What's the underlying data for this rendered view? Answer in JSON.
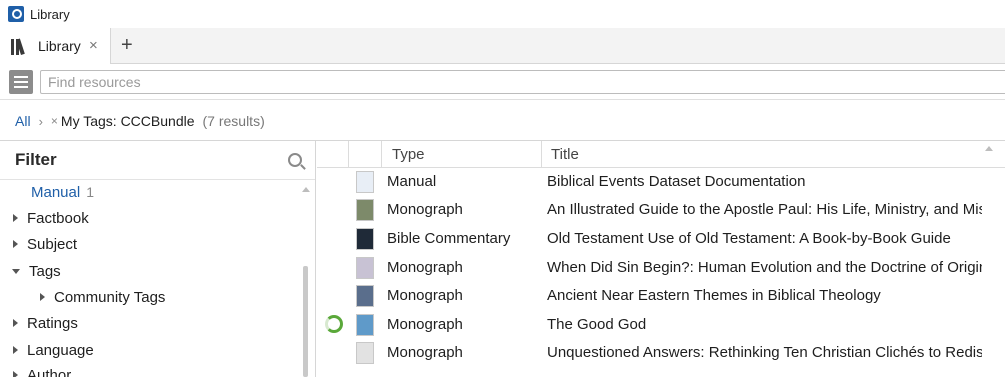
{
  "window": {
    "title": "Library"
  },
  "tabs": [
    {
      "label": "Library",
      "close": "×"
    }
  ],
  "add_tab": "+",
  "search": {
    "placeholder": "Find resources",
    "value": ""
  },
  "breadcrumb": {
    "all": "All",
    "separator": "›",
    "remove": "×",
    "tag": "My Tags: CCCBundle",
    "count": "(7 results)"
  },
  "filter": {
    "title": "Filter",
    "items": [
      {
        "label": "Manual",
        "count": "1",
        "state": "link"
      },
      {
        "label": "Factbook",
        "state": "collapsed"
      },
      {
        "label": "Subject",
        "state": "collapsed"
      },
      {
        "label": "Tags",
        "state": "expanded"
      },
      {
        "label": "Community Tags",
        "state": "collapsed",
        "indent": true
      },
      {
        "label": "Ratings",
        "state": "collapsed"
      },
      {
        "label": "Language",
        "state": "collapsed"
      },
      {
        "label": "Author",
        "state": "collapsed"
      }
    ]
  },
  "table": {
    "columns": [
      "Type",
      "Title"
    ],
    "rows": [
      {
        "type": "Manual",
        "title": "Biblical Events Dataset Documentation",
        "cover": "#e8eef6",
        "loading": false
      },
      {
        "type": "Monograph",
        "title": "An Illustrated Guide to the Apostle Paul: His Life, Ministry, and Missio",
        "cover": "#7d8a6a",
        "loading": false
      },
      {
        "type": "Bible Commentary",
        "title": "Old Testament Use of Old Testament: A Book-by-Book Guide",
        "cover": "#1f2a38",
        "loading": false
      },
      {
        "type": "Monograph",
        "title": "When Did Sin Begin?: Human Evolution and the Doctrine of Original S",
        "cover": "#c8c2d4",
        "loading": false
      },
      {
        "type": "Monograph",
        "title": "Ancient Near Eastern Themes in Biblical Theology",
        "cover": "#5a6e8c",
        "loading": false
      },
      {
        "type": "Monograph",
        "title": "The Good God",
        "cover": "#5f9ac9",
        "loading": true
      },
      {
        "type": "Monograph",
        "title": "Unquestioned Answers: Rethinking Ten Christian Clichés to Rediscov",
        "cover": "#e2e2e2",
        "loading": false
      }
    ]
  },
  "colors": {
    "accent": "#1f5fa8",
    "progress": "#5aa83a"
  }
}
